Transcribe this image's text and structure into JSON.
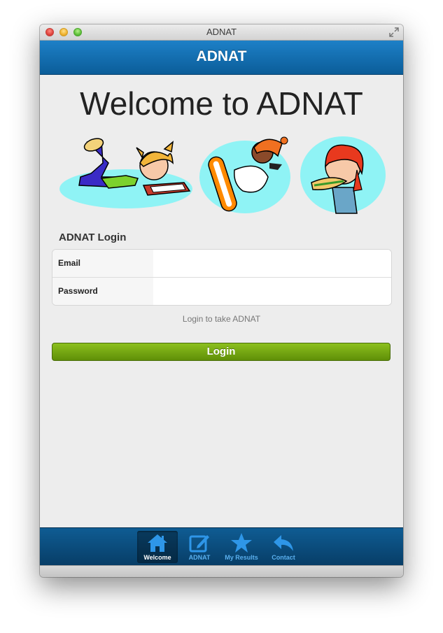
{
  "window": {
    "title": "ADNAT"
  },
  "header": {
    "title": "ADNAT"
  },
  "main": {
    "welcome": "Welcome to ADNAT",
    "login": {
      "heading": "ADNAT Login",
      "fields": [
        {
          "label": "Email",
          "value": "",
          "placeholder": ""
        },
        {
          "label": "Password",
          "value": "",
          "placeholder": ""
        }
      ],
      "hint": "Login to take ADNAT",
      "button": "Login"
    }
  },
  "tabbar": {
    "tabs": [
      {
        "label": "Welcome",
        "icon": "home-icon",
        "active": true
      },
      {
        "label": "ADNAT",
        "icon": "edit-icon",
        "active": false
      },
      {
        "label": "My Results",
        "icon": "star-icon",
        "active": false
      },
      {
        "label": "Contact",
        "icon": "reply-icon",
        "active": false
      }
    ]
  },
  "colors": {
    "header": "#1d80c7",
    "login_button": "#7aa812",
    "tab_active_label": "#ffffff",
    "tab_inactive": "#5ab0ef"
  }
}
